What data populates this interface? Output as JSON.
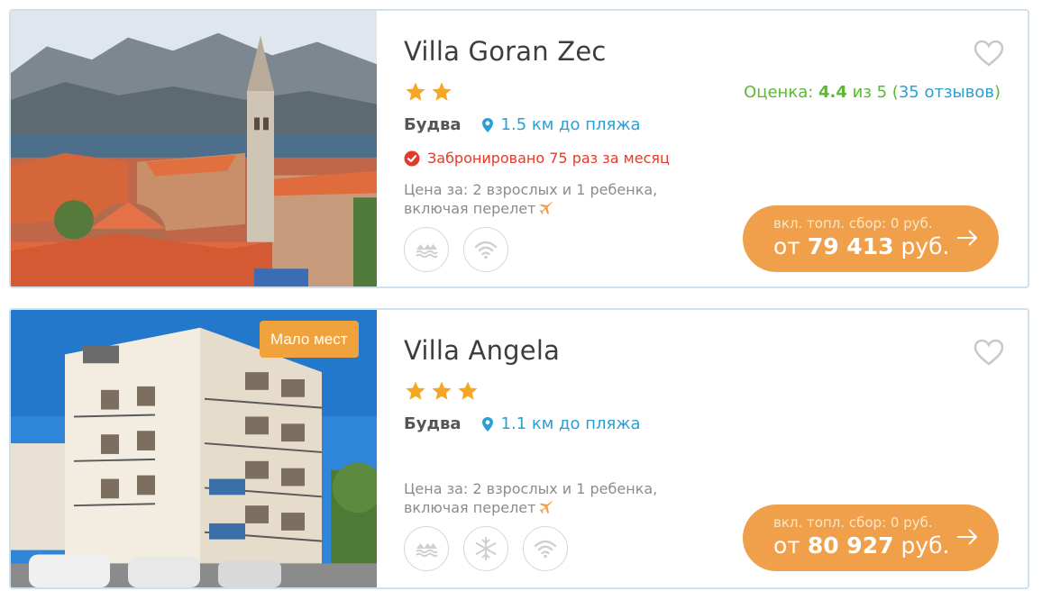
{
  "hotels": [
    {
      "name": "Villa Goran Zec",
      "stars": 2,
      "rating": {
        "label": "Оценка: ",
        "score": "4.4",
        "scale": " из 5 (",
        "reviews": "35 отзывов",
        "close": ")"
      },
      "city": "Будва",
      "beach": "1.5 км до пляжа",
      "booked": "Забронировано 75 раз за месяц",
      "price_note_line1": "Цена за: 2 взрослых и 1 ребенка,",
      "price_note_line2": "включая перелет",
      "fee": "вкл. топл. сбор: 0 руб.",
      "price_prefix": "от ",
      "price_amount": "79 413",
      "price_currency": " руб.",
      "amenities": [
        "pool-icon",
        "wifi-icon"
      ]
    },
    {
      "name": "Villa Angela",
      "stars": 3,
      "badge": "Мало мест",
      "city": "Будва",
      "beach": "1.1 км до пляжа",
      "price_note_line1": "Цена за: 2 взрослых и 1 ребенка,",
      "price_note_line2": "включая перелет",
      "fee": "вкл. топл. сбор: 0 руб.",
      "price_prefix": "от ",
      "price_amount": "80 927",
      "price_currency": " руб.",
      "amenities": [
        "pool-icon",
        "snowflake-icon",
        "wifi-icon"
      ]
    }
  ],
  "colors": {
    "accent_orange": "#f0a04a",
    "link_blue": "#2a9fd6",
    "rating_green": "#5bb92f",
    "booked_red": "#e33b2a",
    "star": "#f5a623"
  }
}
